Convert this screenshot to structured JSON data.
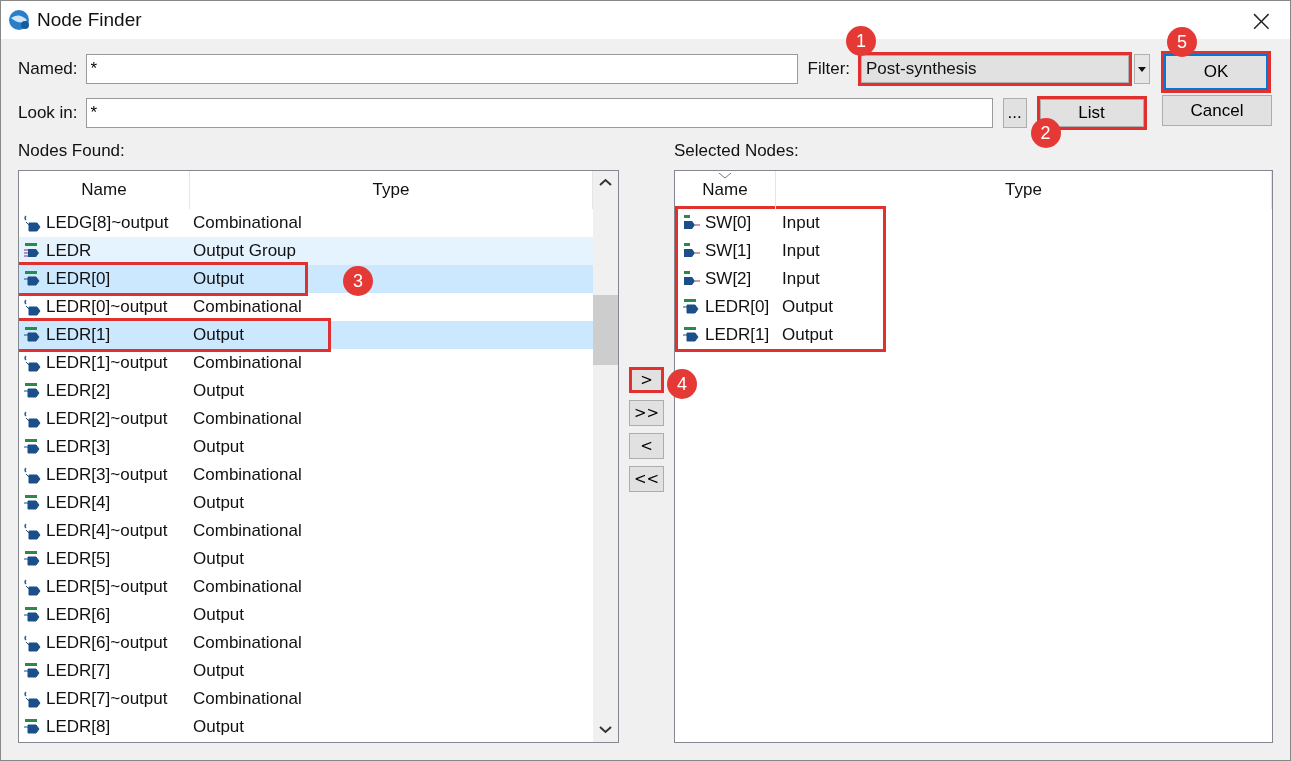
{
  "window": {
    "title": "Node Finder",
    "close": "×"
  },
  "named": {
    "label": "Named:",
    "value": "*"
  },
  "filter": {
    "label": "Filter:",
    "value": "Post-synthesis",
    "outlined": true,
    "callout": "1"
  },
  "look_in": {
    "label": "Look in:",
    "value": "*",
    "browse": "..."
  },
  "list_button": {
    "label": "List",
    "outlined": true,
    "callout": "2"
  },
  "ok_button": {
    "label": "OK",
    "outlined": true,
    "callout": "5"
  },
  "cancel_button": {
    "label": "Cancel"
  },
  "nodes_found": {
    "title": "Nodes Found:",
    "columns": [
      "Name",
      "Type"
    ],
    "rows": [
      {
        "name": "LEDG[8]~output",
        "type": "Combinational",
        "kind": "combinational",
        "selected": false,
        "hovered": false,
        "outlined": false
      },
      {
        "name": "LEDR",
        "type": "Output Group",
        "kind": "group",
        "selected": false,
        "hovered": true,
        "outlined": false
      },
      {
        "name": "LEDR[0]",
        "type": "Output",
        "kind": "output",
        "selected": true,
        "hovered": false,
        "outlined": true,
        "callout": "3"
      },
      {
        "name": "LEDR[0]~output",
        "type": "Combinational",
        "kind": "combinational",
        "selected": false,
        "hovered": false,
        "outlined": false
      },
      {
        "name": "LEDR[1]",
        "type": "Output",
        "kind": "output",
        "selected": true,
        "hovered": false,
        "outlined": true
      },
      {
        "name": "LEDR[1]~output",
        "type": "Combinational",
        "kind": "combinational",
        "selected": false,
        "hovered": false,
        "outlined": false
      },
      {
        "name": "LEDR[2]",
        "type": "Output",
        "kind": "output",
        "selected": false,
        "hovered": false,
        "outlined": false
      },
      {
        "name": "LEDR[2]~output",
        "type": "Combinational",
        "kind": "combinational",
        "selected": false,
        "hovered": false,
        "outlined": false
      },
      {
        "name": "LEDR[3]",
        "type": "Output",
        "kind": "output",
        "selected": false,
        "hovered": false,
        "outlined": false
      },
      {
        "name": "LEDR[3]~output",
        "type": "Combinational",
        "kind": "combinational",
        "selected": false,
        "hovered": false,
        "outlined": false
      },
      {
        "name": "LEDR[4]",
        "type": "Output",
        "kind": "output",
        "selected": false,
        "hovered": false,
        "outlined": false
      },
      {
        "name": "LEDR[4]~output",
        "type": "Combinational",
        "kind": "combinational",
        "selected": false,
        "hovered": false,
        "outlined": false
      },
      {
        "name": "LEDR[5]",
        "type": "Output",
        "kind": "output",
        "selected": false,
        "hovered": false,
        "outlined": false
      },
      {
        "name": "LEDR[5]~output",
        "type": "Combinational",
        "kind": "combinational",
        "selected": false,
        "hovered": false,
        "outlined": false
      },
      {
        "name": "LEDR[6]",
        "type": "Output",
        "kind": "output",
        "selected": false,
        "hovered": false,
        "outlined": false
      },
      {
        "name": "LEDR[6]~output",
        "type": "Combinational",
        "kind": "combinational",
        "selected": false,
        "hovered": false,
        "outlined": false
      },
      {
        "name": "LEDR[7]",
        "type": "Output",
        "kind": "output",
        "selected": false,
        "hovered": false,
        "outlined": false
      },
      {
        "name": "LEDR[7]~output",
        "type": "Combinational",
        "kind": "combinational",
        "selected": false,
        "hovered": false,
        "outlined": false
      },
      {
        "name": "LEDR[8]",
        "type": "Output",
        "kind": "output",
        "selected": false,
        "hovered": false,
        "outlined": false
      }
    ]
  },
  "move_buttons": [
    {
      "label": ">",
      "outlined": true,
      "callout": "4"
    },
    {
      "label": ">>",
      "outlined": false
    },
    {
      "label": "<",
      "outlined": false
    },
    {
      "label": "<<",
      "outlined": false
    }
  ],
  "selected_nodes": {
    "title": "Selected Nodes:",
    "columns": [
      "Name",
      "Type"
    ],
    "outlined": true,
    "rows": [
      {
        "name": "SW[0]",
        "type": "Input",
        "kind": "input"
      },
      {
        "name": "SW[1]",
        "type": "Input",
        "kind": "input"
      },
      {
        "name": "SW[2]",
        "type": "Input",
        "kind": "input"
      },
      {
        "name": "LEDR[0]",
        "type": "Output",
        "kind": "output"
      },
      {
        "name": "LEDR[1]",
        "type": "Output",
        "kind": "output"
      }
    ]
  }
}
